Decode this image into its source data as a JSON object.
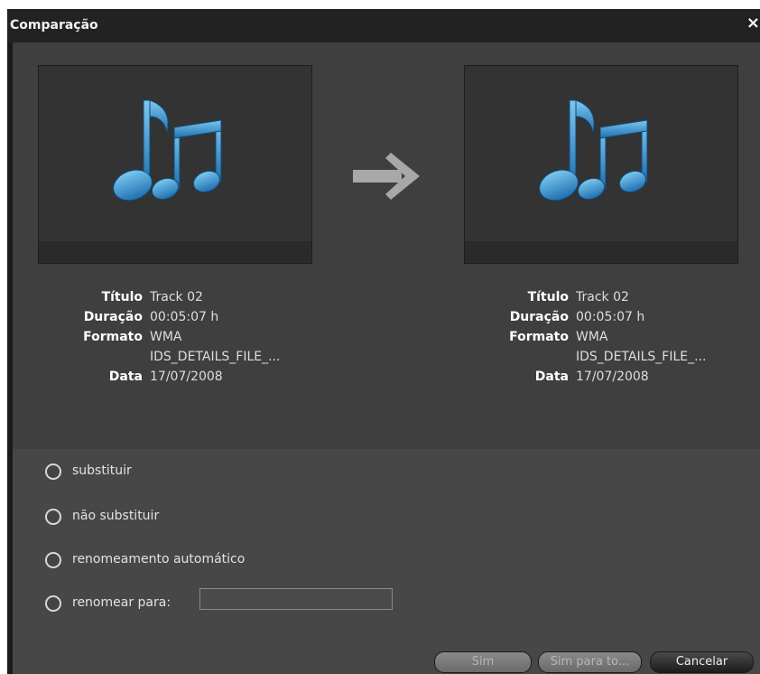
{
  "window": {
    "title": "Comparação",
    "close_label": "×"
  },
  "source": {
    "icon": "music-notes-icon",
    "labels": {
      "title": "Título",
      "duration": "Duração",
      "format": "Formato",
      "date": "Data"
    },
    "values": {
      "title": "Track 02",
      "duration": "00:05:07 h",
      "format": "WMA",
      "format_detail": "IDS_DETAILS_FILE_...",
      "date": "17/07/2008"
    }
  },
  "arrow_icon": "arrow-right-icon",
  "target": {
    "icon": "music-notes-icon",
    "labels": {
      "title": "Título",
      "duration": "Duração",
      "format": "Formato",
      "date": "Data"
    },
    "values": {
      "title": "Track 02",
      "duration": "00:05:07 h",
      "format": "WMA",
      "format_detail": "IDS_DETAILS_FILE_...",
      "date": "17/07/2008"
    }
  },
  "options": {
    "replace": "substituir",
    "dont_replace": "não substituir",
    "auto_rename": "renomeamento automático",
    "rename_to": "renomear para:",
    "rename_value": ""
  },
  "buttons": {
    "yes": "Sim",
    "yes_all": "Sim para to...",
    "cancel": "Cancelar"
  },
  "colors": {
    "note_blue": "#2f8fd0",
    "background": "#3c3c3c",
    "titlebar": "#222222"
  }
}
